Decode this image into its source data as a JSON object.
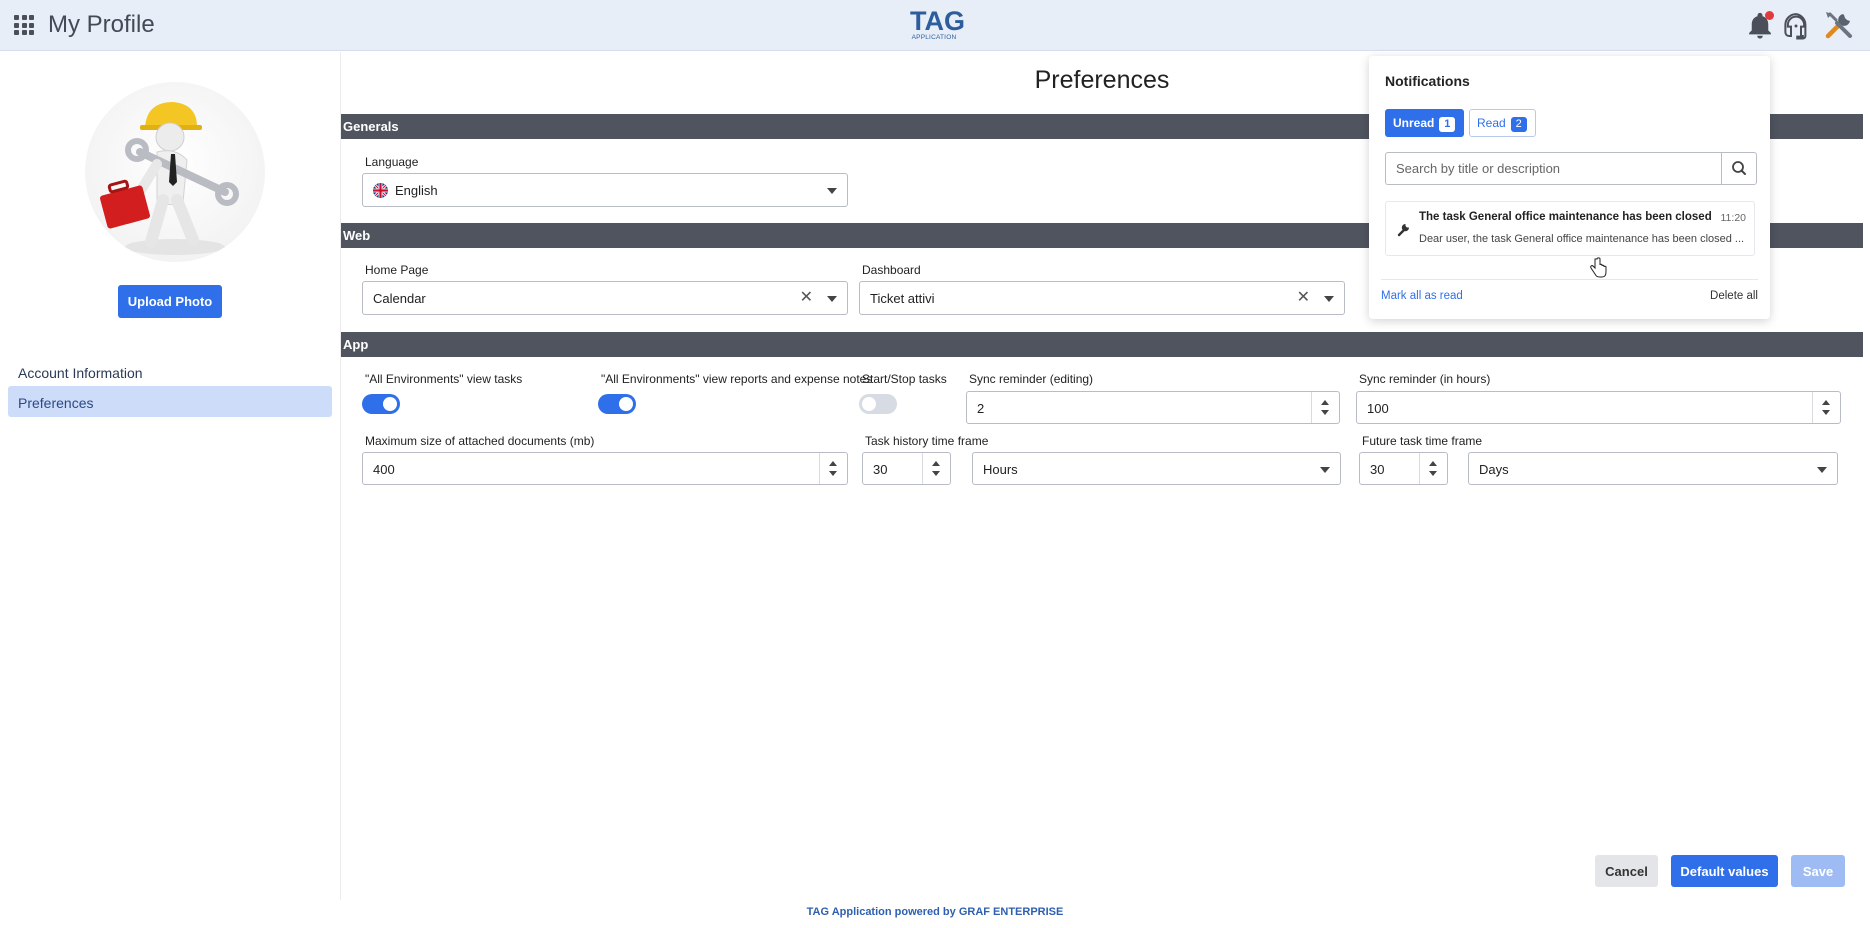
{
  "header": {
    "app_title": "My Profile",
    "logo_main": "TAG",
    "logo_sub": "APPLICATION",
    "icons": [
      "apps-grid-icon",
      "bell-icon",
      "headset-icon",
      "tools-icon"
    ],
    "accent_color": "#2f6fea"
  },
  "sidebar": {
    "upload_label": "Upload Photo",
    "items": [
      {
        "label": "Account Information",
        "active": false
      },
      {
        "label": "Preferences",
        "active": true
      }
    ]
  },
  "main": {
    "page_title": "Preferences",
    "sections": {
      "generals": "Generals",
      "web": "Web",
      "app": "App"
    },
    "generals": {
      "language_label": "Language",
      "language_value": "English"
    },
    "web": {
      "home_page_label": "Home Page",
      "home_page_value": "Calendar",
      "dashboard_label": "Dashboard",
      "dashboard_value": "Ticket attivi"
    },
    "app": {
      "view_tasks_label": "\"All Environments\" view tasks",
      "view_tasks_on": true,
      "view_reports_label": "\"All Environments\" view reports and expense notes",
      "view_reports_on": true,
      "start_stop_label": "Start/Stop tasks",
      "start_stop_on": false,
      "sync_editing_label": "Sync reminder (editing)",
      "sync_editing_value": "2",
      "sync_hours_label": "Sync reminder (in hours)",
      "sync_hours_value": "100",
      "max_size_label": "Maximum size of attached documents (mb)",
      "max_size_value": "400",
      "history_label": "Task history time frame",
      "history_value": "30",
      "history_unit": "Hours",
      "future_label": "Future task time frame",
      "future_value": "30",
      "future_unit": "Days"
    },
    "buttons": {
      "cancel": "Cancel",
      "default_values": "Default values",
      "save": "Save"
    }
  },
  "footer": {
    "text": "TAG Application powered by GRAF ENTERPRISE"
  },
  "notifications": {
    "title": "Notifications",
    "unread_label": "Unread",
    "unread_count": "1",
    "read_label": "Read",
    "read_count": "2",
    "search_placeholder": "Search by title or description",
    "items": [
      {
        "title": "The task General office maintenance has been closed",
        "time": "11:20",
        "description": "Dear user, the task General office maintenance has been closed ..."
      }
    ],
    "mark_all_read": "Mark all as read",
    "delete_all": "Delete all"
  }
}
